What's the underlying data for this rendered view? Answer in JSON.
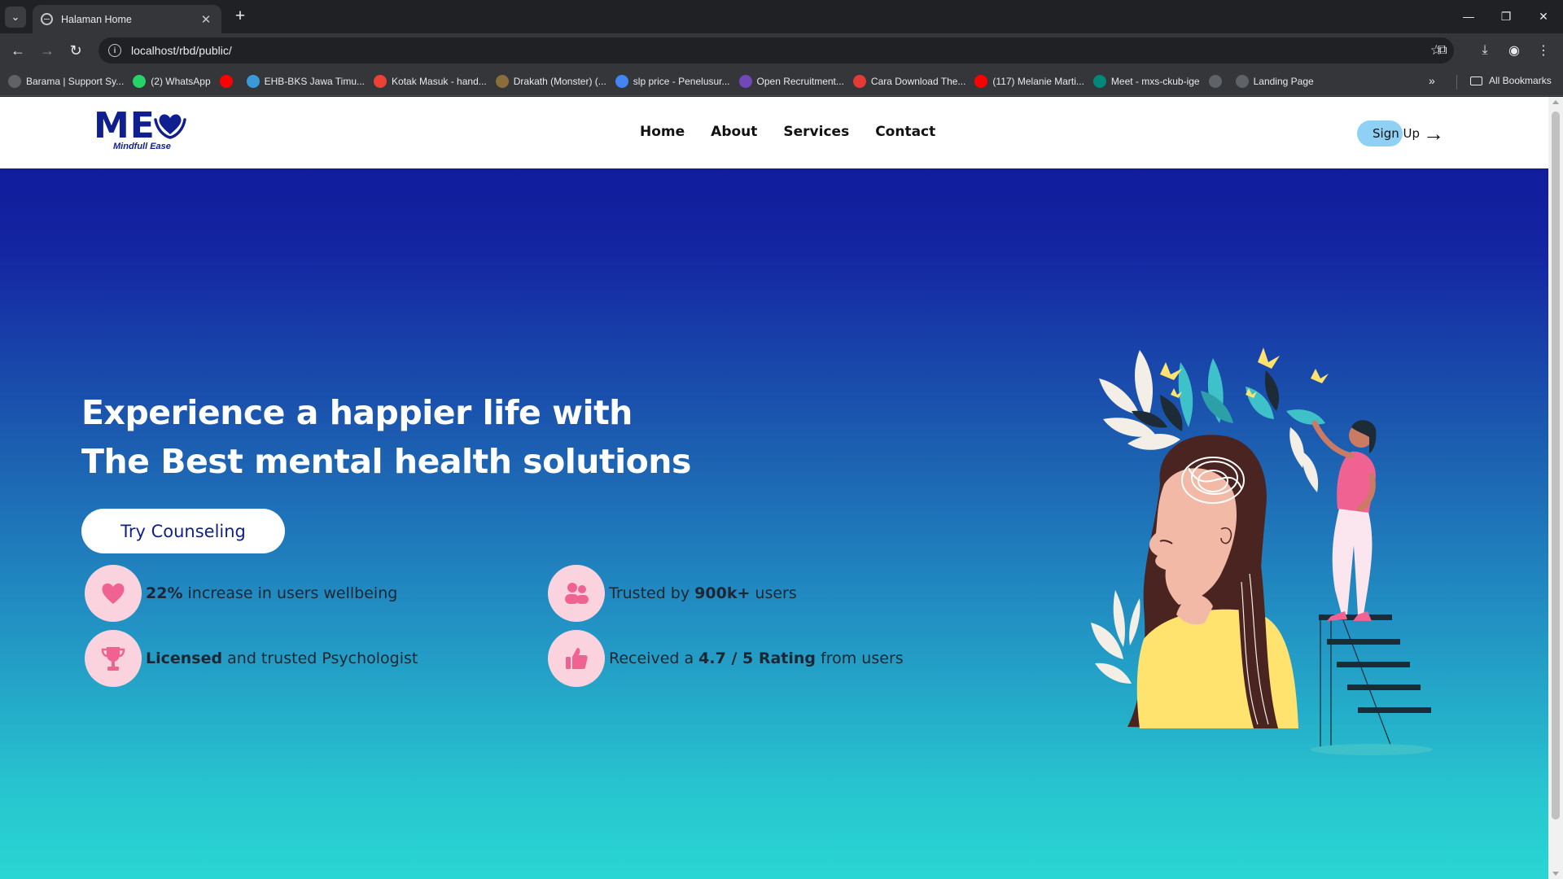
{
  "browser": {
    "tab_title": "Halaman Home",
    "url": "localhost/rbd/public/",
    "bookmarks": [
      {
        "label": "Barama | Support Sy...",
        "icon": "globe-icon",
        "color": "#5f6368"
      },
      {
        "label": "(2) WhatsApp",
        "icon": "whatsapp-icon",
        "color": "#25d366"
      },
      {
        "label": "",
        "icon": "youtube-icon",
        "color": "#ff0000"
      },
      {
        "label": "EHB-BKS Jawa Timu...",
        "icon": "site-icon",
        "color": "#3a9ad9"
      },
      {
        "label": "Kotak Masuk - hand...",
        "icon": "gmail-icon",
        "color": "#ea4335"
      },
      {
        "label": "Drakath (Monster) (...",
        "icon": "site-icon",
        "color": "#8a6d3b"
      },
      {
        "label": "slp price - Penelusur...",
        "icon": "google-icon",
        "color": "#4285f4"
      },
      {
        "label": "Open Recruitment...",
        "icon": "forms-icon",
        "color": "#7248b9"
      },
      {
        "label": "Cara Download The...",
        "icon": "site-icon",
        "color": "#e53935"
      },
      {
        "label": "(117) Melanie Marti...",
        "icon": "youtube-icon",
        "color": "#ff0000"
      },
      {
        "label": "Meet - mxs-ckub-ige",
        "icon": "meet-icon",
        "color": "#00897b"
      },
      {
        "label": "",
        "icon": "globe-icon",
        "color": "#5f6368"
      },
      {
        "label": "Landing Page",
        "icon": "globe-icon",
        "color": "#5f6368"
      }
    ],
    "more_bookmarks": "»",
    "all_bookmarks": "All Bookmarks"
  },
  "site": {
    "logo_text": "ME",
    "logo_subtitle": "Mindfull Ease",
    "nav": [
      "Home",
      "About",
      "Services",
      "Contact"
    ],
    "signup": "Sign Up",
    "hero": {
      "line1": "Experience a happier life with",
      "line2": "The Best mental health solutions",
      "cta": "Try Counseling"
    },
    "stats": [
      {
        "bold": "22%",
        "rest": " increase in users wellbeing",
        "icon": "heart-icon"
      },
      {
        "pre": "Trusted by ",
        "bold": "900k+",
        "rest": " users",
        "icon": "users-icon"
      },
      {
        "bold": "Licensed",
        "rest": " and trusted Psychologist",
        "icon": "trophy-icon"
      },
      {
        "pre": "Received a ",
        "bold": "4.7 / 5 Rating",
        "rest": " from users",
        "icon": "thumbs-up-icon"
      }
    ]
  },
  "colors": {
    "brand": "#0f1f8f",
    "accent_pink": "#f06292",
    "signup_pill": "#8fd0f5"
  }
}
